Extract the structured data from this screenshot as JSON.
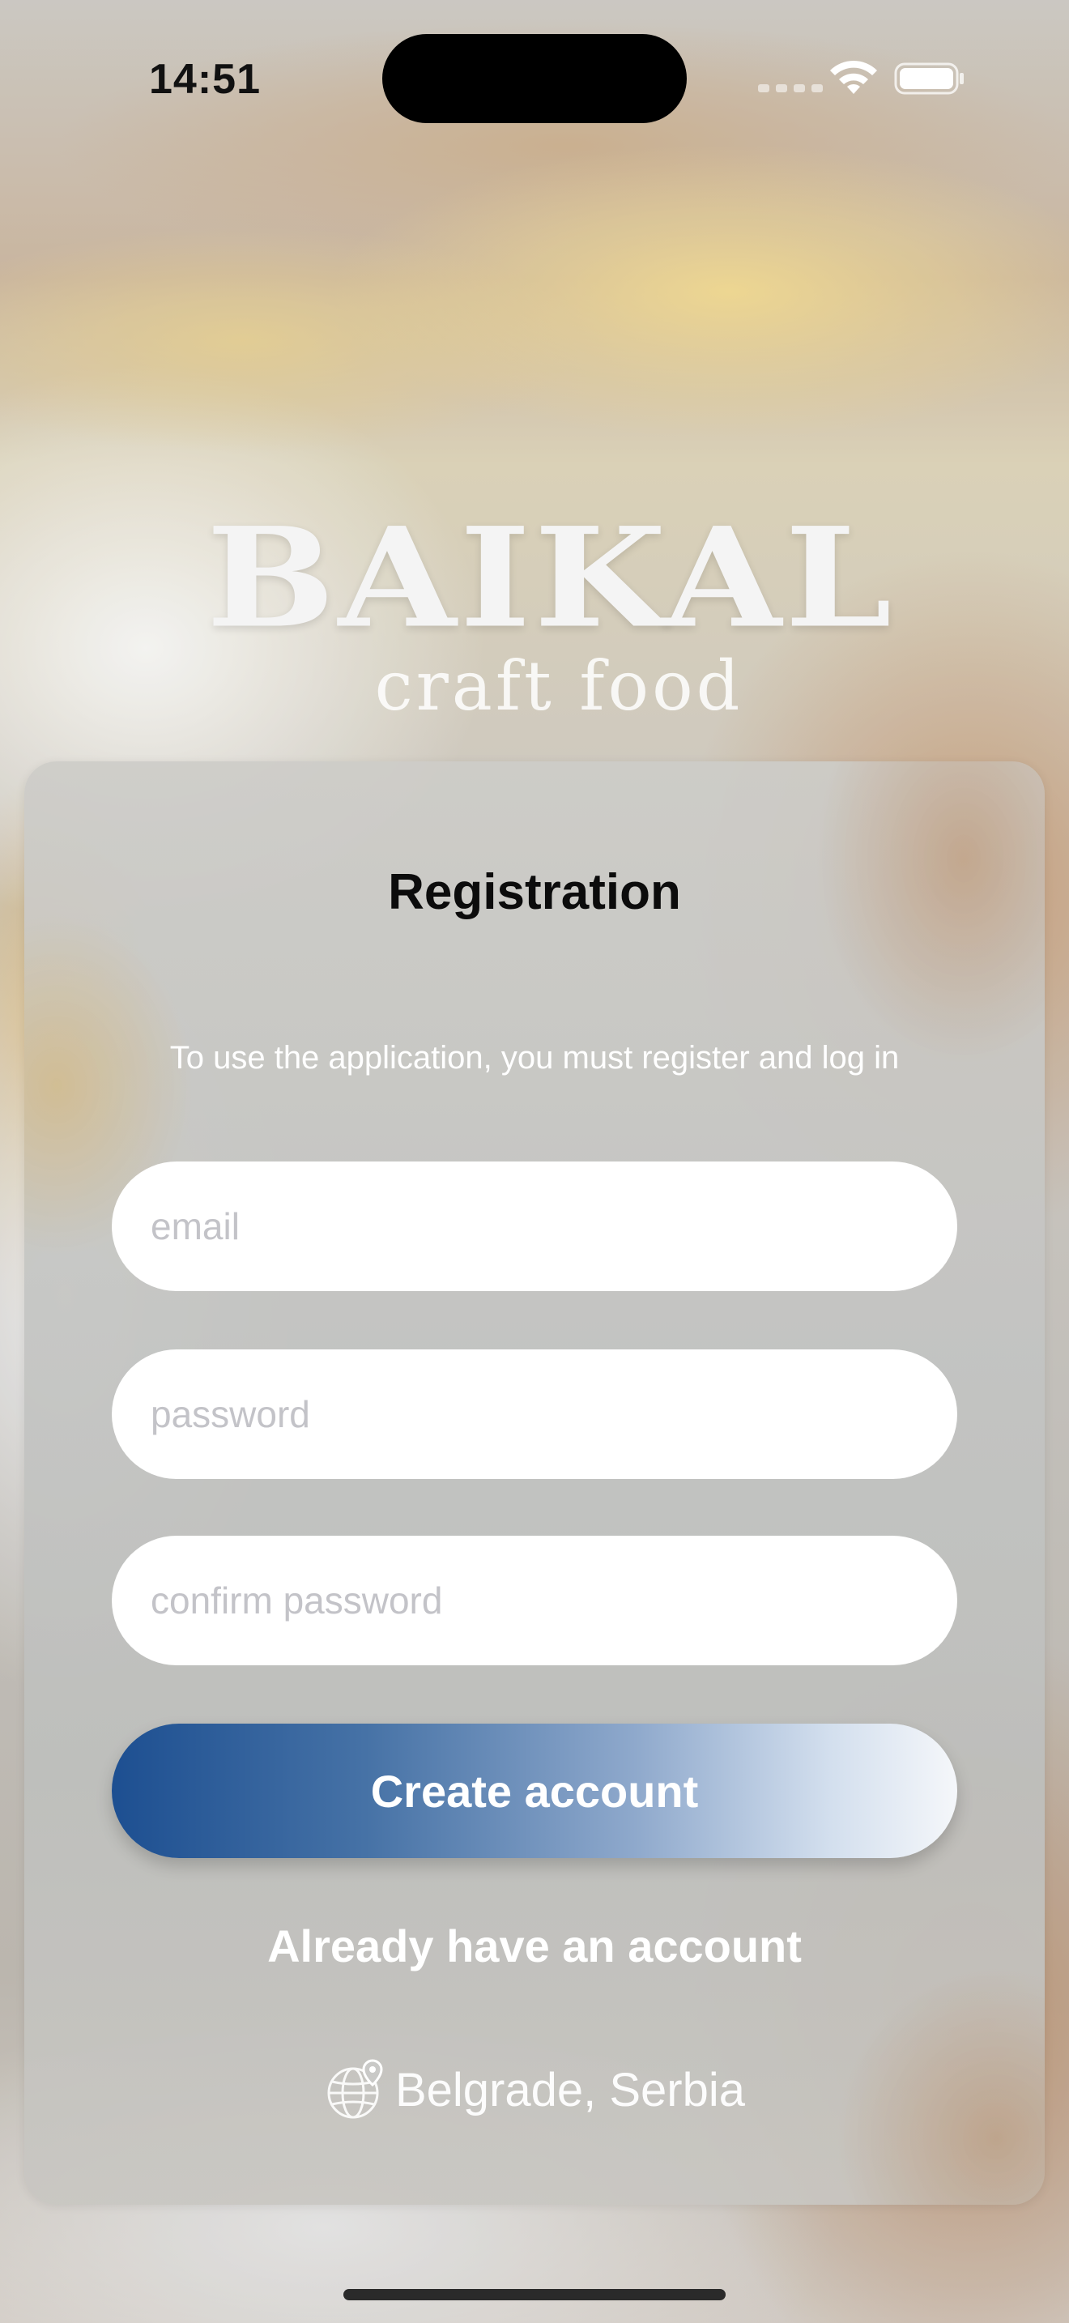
{
  "status_bar": {
    "time": "14:51",
    "icons": [
      "signal-icon",
      "wifi-icon",
      "battery-icon"
    ]
  },
  "brand": {
    "title": "BAIKAL",
    "subtitle": "craft food"
  },
  "registration": {
    "title": "Registration",
    "subtitle": "To use the application, you must register and log in",
    "email_placeholder": "email",
    "password_placeholder": "password",
    "confirm_placeholder": "confirm password",
    "create_button": "Create account",
    "login_link": "Already have an account",
    "location": "Belgrade, Serbia",
    "location_icon": "globe-location-icon"
  },
  "colors": {
    "button_gradient_start": "#1d4f91",
    "button_gradient_end": "#f5f7fa",
    "title_text": "#0c0c0c",
    "field_background": "#ffffff"
  }
}
